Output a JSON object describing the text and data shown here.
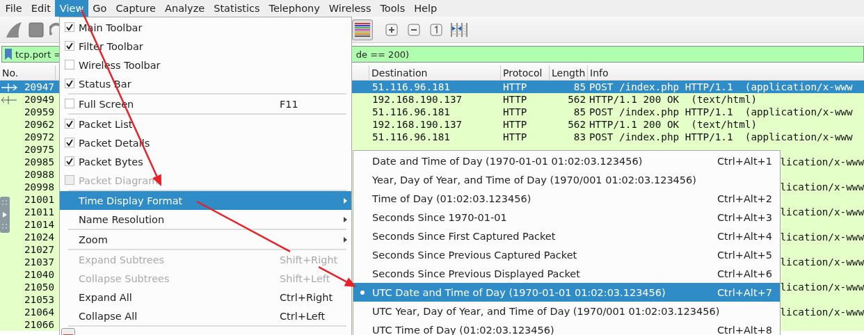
{
  "menu_bar": [
    {
      "label": "File",
      "selected": false
    },
    {
      "label": "Edit",
      "selected": false
    },
    {
      "label": "View",
      "selected": true
    },
    {
      "label": "Go",
      "selected": false
    },
    {
      "label": "Capture",
      "selected": false
    },
    {
      "label": "Analyze",
      "selected": false
    },
    {
      "label": "Statistics",
      "selected": false
    },
    {
      "label": "Telephony",
      "selected": false
    },
    {
      "label": "Wireless",
      "selected": false
    },
    {
      "label": "Tools",
      "selected": false
    },
    {
      "label": "Help",
      "selected": false
    }
  ],
  "toolbar": {
    "colorize_pressed": true
  },
  "display_filter": {
    "text_left": "tcp.port =",
    "text_right": "de == 200)"
  },
  "packet_list": {
    "columns": [
      {
        "label": "No."
      },
      {
        "label": "Destination"
      },
      {
        "label": "Protocol"
      },
      {
        "label": "Length"
      },
      {
        "label": "Info"
      }
    ],
    "rows": [
      {
        "no": "20947",
        "selected": true,
        "kind": "request",
        "destination": "51.116.96.181",
        "protocol": "HTTP",
        "length": "85",
        "info": "POST /index.php HTTP/1.1  (application/x-www"
      },
      {
        "no": "20949",
        "selected": false,
        "kind": "response",
        "destination": "192.168.190.137",
        "protocol": "HTTP",
        "length": "562",
        "info": "HTTP/1.1 200 OK  (text/html)"
      },
      {
        "no": "20959",
        "selected": false,
        "kind": "plain",
        "destination": "51.116.96.181",
        "protocol": "HTTP",
        "length": "85",
        "info": "POST /index.php HTTP/1.1  (application/x-www"
      },
      {
        "no": "20962",
        "selected": false,
        "kind": "plain",
        "destination": "192.168.190.137",
        "protocol": "HTTP",
        "length": "562",
        "info": "HTTP/1.1 200 OK  (text/html)"
      },
      {
        "no": "20972",
        "selected": false,
        "kind": "plain",
        "destination": "51.116.96.181",
        "protocol": "HTTP",
        "length": "83",
        "info": "POST /index.php HTTP/1.1  (application/x-www"
      },
      {
        "no": "20975",
        "selected": false,
        "kind": "plain"
      },
      {
        "no": "20985",
        "selected": false,
        "kind": "plain",
        "info_tail": "lication/x-www"
      },
      {
        "no": "20988",
        "selected": false,
        "kind": "plain"
      },
      {
        "no": "20998",
        "selected": false,
        "kind": "plain",
        "info_tail": "lication/x-www"
      },
      {
        "no": "21001",
        "selected": false,
        "kind": "plain"
      },
      {
        "no": "21011",
        "selected": false,
        "kind": "plain",
        "info_tail": "lication/x-www"
      },
      {
        "no": "21014",
        "selected": false,
        "kind": "plain"
      },
      {
        "no": "21024",
        "selected": false,
        "kind": "plain",
        "info_tail": "lication/x-www"
      },
      {
        "no": "21027",
        "selected": false,
        "kind": "plain"
      },
      {
        "no": "21037",
        "selected": false,
        "kind": "plain",
        "info_tail": "lication/x-www"
      },
      {
        "no": "21040",
        "selected": false,
        "kind": "plain"
      },
      {
        "no": "21050",
        "selected": false,
        "kind": "plain",
        "info_tail": "lication/x-www"
      },
      {
        "no": "21053",
        "selected": false,
        "kind": "plain"
      },
      {
        "no": "21064",
        "selected": false,
        "kind": "plain",
        "info_tail": "lication/x-www"
      },
      {
        "no": "21066",
        "selected": false,
        "kind": "plain"
      }
    ]
  },
  "view_menu": {
    "items": [
      {
        "kind": "check",
        "label": "Main Toolbar",
        "checked": true,
        "disabled": false,
        "highlighted": false
      },
      {
        "kind": "check",
        "label": "Filter Toolbar",
        "checked": true,
        "disabled": false,
        "highlighted": false
      },
      {
        "kind": "check",
        "label": "Wireless Toolbar",
        "checked": false,
        "disabled": false,
        "highlighted": false
      },
      {
        "kind": "check",
        "label": "Status Bar",
        "checked": true,
        "disabled": false,
        "highlighted": false
      },
      {
        "kind": "separator"
      },
      {
        "kind": "check",
        "label": "Full Screen",
        "shortcut": "F11",
        "checked": false,
        "disabled": false,
        "highlighted": false
      },
      {
        "kind": "separator"
      },
      {
        "kind": "check",
        "label": "Packet List",
        "checked": true,
        "disabled": false,
        "highlighted": false
      },
      {
        "kind": "check",
        "label": "Packet Details",
        "checked": true,
        "disabled": false,
        "highlighted": false
      },
      {
        "kind": "check",
        "label": "Packet Bytes",
        "checked": true,
        "disabled": false,
        "highlighted": false
      },
      {
        "kind": "check",
        "label": "Packet Diagram",
        "checked": false,
        "disabled": true,
        "highlighted": false
      },
      {
        "kind": "separator"
      },
      {
        "kind": "submenu",
        "label": "Time Display Format",
        "disabled": false,
        "highlighted": true
      },
      {
        "kind": "submenu",
        "label": "Name Resolution",
        "disabled": false,
        "highlighted": false
      },
      {
        "kind": "separator"
      },
      {
        "kind": "submenu",
        "label": "Zoom",
        "disabled": false,
        "highlighted": false
      },
      {
        "kind": "separator"
      },
      {
        "kind": "action",
        "label": "Expand Subtrees",
        "shortcut": "Shift+Right",
        "disabled": true,
        "highlighted": false
      },
      {
        "kind": "action",
        "label": "Collapse Subtrees",
        "shortcut": "Shift+Left",
        "disabled": true,
        "highlighted": false
      },
      {
        "kind": "action",
        "label": "Expand All",
        "shortcut": "Ctrl+Right",
        "disabled": false,
        "highlighted": false
      },
      {
        "kind": "action",
        "label": "Collapse All",
        "shortcut": "Ctrl+Left",
        "disabled": false,
        "highlighted": false
      },
      {
        "kind": "separator"
      },
      {
        "kind": "icon_action",
        "disabled": false,
        "highlighted": false
      }
    ]
  },
  "time_format_menu": {
    "items": [
      {
        "label": "Date and Time of Day (1970-01-01 01:02:03.123456)",
        "shortcut": "Ctrl+Alt+1",
        "selected": false,
        "highlighted": false
      },
      {
        "label": "Year, Day of Year, and Time of Day (1970/001 01:02:03.123456)",
        "selected": false,
        "highlighted": false
      },
      {
        "label": "Time of Day (01:02:03.123456)",
        "shortcut": "Ctrl+Alt+2",
        "selected": false,
        "highlighted": false
      },
      {
        "label": "Seconds Since 1970-01-01",
        "shortcut": "Ctrl+Alt+3",
        "selected": false,
        "highlighted": false
      },
      {
        "label": "Seconds Since First Captured Packet",
        "shortcut": "Ctrl+Alt+4",
        "selected": false,
        "highlighted": false
      },
      {
        "label": "Seconds Since Previous Captured Packet",
        "shortcut": "Ctrl+Alt+5",
        "selected": false,
        "highlighted": false
      },
      {
        "label": "Seconds Since Previous Displayed Packet",
        "shortcut": "Ctrl+Alt+6",
        "selected": false,
        "highlighted": false
      },
      {
        "label": "UTC Date and Time of Day (1970-01-01 01:02:03.123456)",
        "shortcut": "Ctrl+Alt+7",
        "selected": true,
        "highlighted": true
      },
      {
        "label": "UTC Year, Day of Year, and Time of Day (1970/001 01:02:03.123456)",
        "selected": false,
        "highlighted": false
      },
      {
        "label": "UTC Time of Day (01:02:03.123456)",
        "shortcut": "Ctrl+Alt+8",
        "selected": false,
        "highlighted": false
      }
    ]
  }
}
